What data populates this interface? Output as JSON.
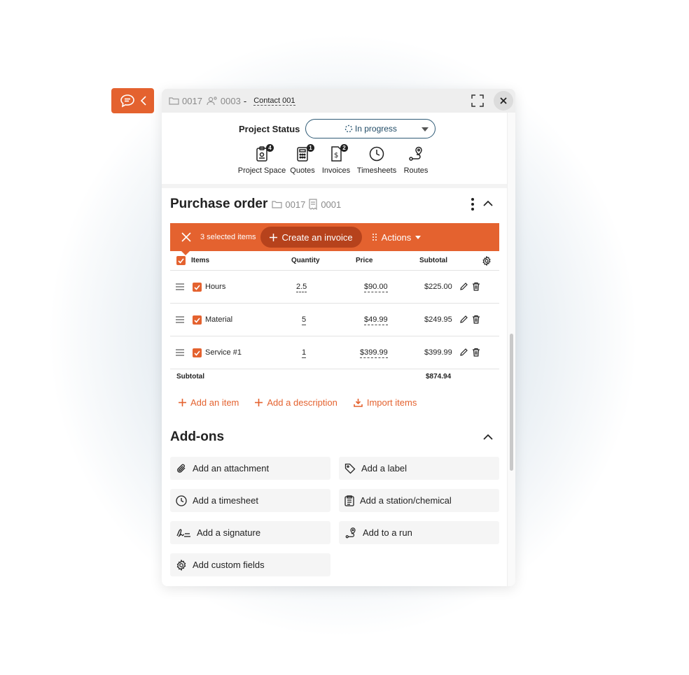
{
  "colors": {
    "accent": "#e4622f",
    "accent_dark": "#b6421c",
    "status_border": "#2f5b76"
  },
  "topbar": {
    "folder_id": "0017",
    "contact_id": "0003",
    "separator": "-",
    "contact_name": "Contact 001"
  },
  "status": {
    "label": "Project Status",
    "value": "In progress"
  },
  "quicklinks": [
    {
      "label": "Project Space",
      "badge": "4",
      "icon": "clipboard-gear-icon"
    },
    {
      "label": "Quotes",
      "badge": "1",
      "icon": "calculator-icon"
    },
    {
      "label": "Invoices",
      "badge": "2",
      "icon": "invoice-dollar-icon"
    },
    {
      "label": "Timesheets",
      "badge": "",
      "icon": "clock-icon"
    },
    {
      "label": "Routes",
      "badge": "",
      "icon": "route-pin-icon"
    }
  ],
  "purchase_order": {
    "title": "Purchase order",
    "folder_id": "0017",
    "po_id": "0001"
  },
  "selection": {
    "count_label": "3 selected items",
    "create_label": "Create an invoice",
    "actions_label": "Actions"
  },
  "table": {
    "columns": {
      "items": "Items",
      "quantity": "Quantity",
      "price": "Price",
      "subtotal": "Subtotal"
    },
    "rows": [
      {
        "name": "Hours",
        "quantity": "2.5",
        "price": "$90.00",
        "subtotal": "$225.00"
      },
      {
        "name": "Material",
        "quantity": "5",
        "price": "$49.99",
        "subtotal": "$249.95"
      },
      {
        "name": "Service #1",
        "quantity": "1",
        "price": "$399.99",
        "subtotal": "$399.99"
      }
    ],
    "footer": {
      "label": "Subtotal",
      "total": "$874.94"
    }
  },
  "add_links": {
    "item": "Add an item",
    "description": "Add a description",
    "import": "Import items"
  },
  "addons": {
    "title": "Add-ons",
    "items": [
      {
        "label": "Add an attachment",
        "icon": "paperclip-icon"
      },
      {
        "label": "Add a label",
        "icon": "tag-icon"
      },
      {
        "label": "Add a timesheet",
        "icon": "clock-icon"
      },
      {
        "label": "Add a station/chemical",
        "icon": "clipboard-list-icon"
      },
      {
        "label": "Add a signature",
        "icon": "signature-icon"
      },
      {
        "label": "Add to a run",
        "icon": "route-pin-icon"
      },
      {
        "label": "Add custom fields",
        "icon": "gear-icon"
      }
    ]
  }
}
